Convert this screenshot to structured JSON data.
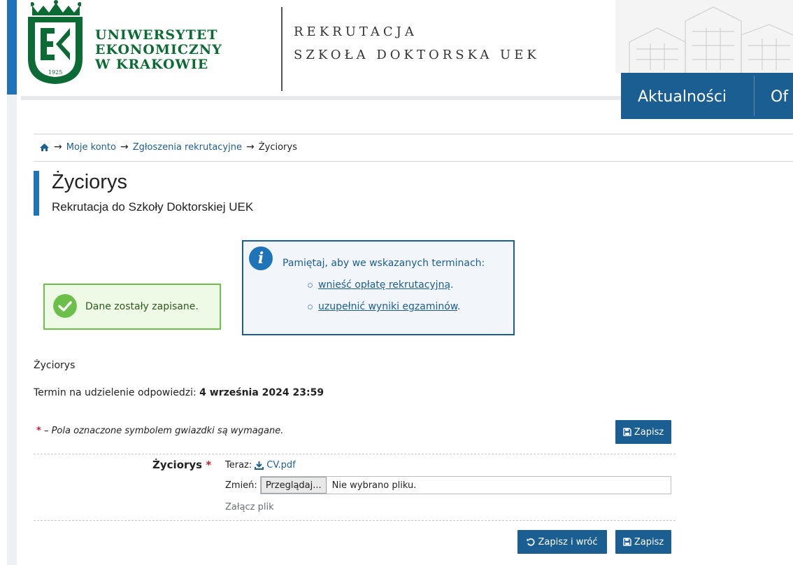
{
  "header": {
    "university_line1": "UNIWERSYTET",
    "university_line2": "EKONOMICZNY",
    "university_line3": "W KRAKOWIE",
    "logo_year": "1925",
    "logo_letters": "EK",
    "recruitment_line1": "REKRUTACJA",
    "recruitment_line2": "SZKOŁA DOKTORSKA UEK",
    "nav": [
      "Aktualności",
      "Of"
    ]
  },
  "breadcrumb": {
    "home_icon": "home-icon",
    "items": [
      "Moje konto",
      "Zgłoszenia rekrutacyjne"
    ],
    "current": "Życiorys"
  },
  "page": {
    "title": "Życiorys",
    "subtitle": "Rekrutacja do Szkoły Doktorskiej UEK"
  },
  "success": {
    "text": "Dane zostały zapisane."
  },
  "info": {
    "text": "Pamiętaj, aby we wskazanych terminach:",
    "items": [
      "wnieść opłatę rekrutacyjną",
      "uzupełnić wyniki egzaminów"
    ],
    "item_suffix": "."
  },
  "section": {
    "label": "Życiorys",
    "deadline_label": "Termin na udzielenie odpowiedzi:",
    "deadline_value": "4 września 2024 23:59",
    "required_star": "*",
    "required_note": "– Pola oznaczone symbolem gwiazdki są wymagane."
  },
  "form": {
    "field_label": "Życiorys",
    "current_label": "Teraz:",
    "current_file": "CV.pdf",
    "change_label": "Zmień:",
    "browse_label": "Przeglądaj...",
    "file_status": "Nie wybrano pliku.",
    "attach_hint": "Załącz plik"
  },
  "buttons": {
    "save": "Zapisz",
    "save_and_back": "Zapisz i wróć"
  },
  "colors": {
    "accent": "#1f73b7",
    "nav": "#1b5e92",
    "brand_green": "#0c6b34",
    "success_border": "#6cc04a",
    "required": "#c0242b"
  }
}
